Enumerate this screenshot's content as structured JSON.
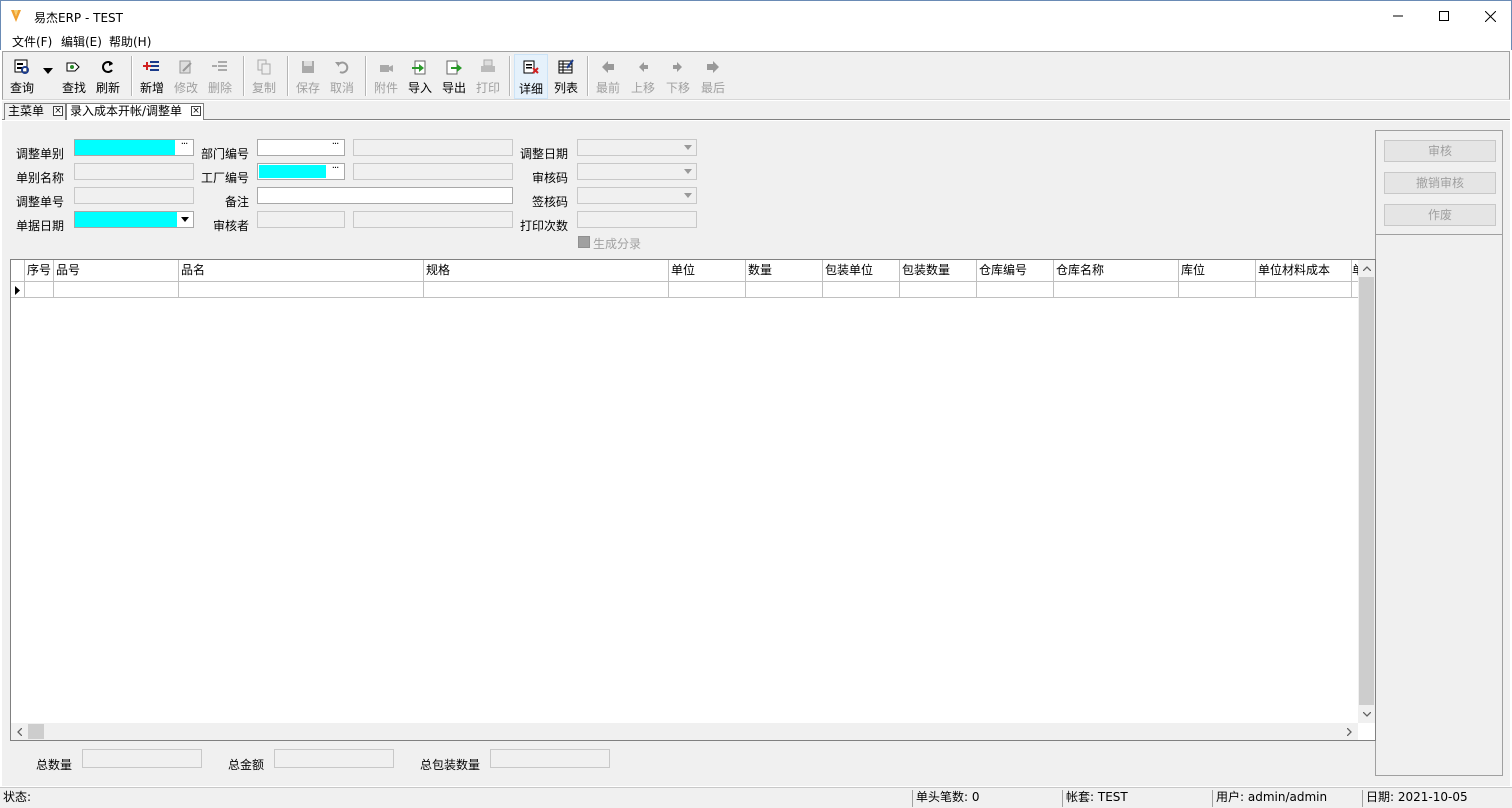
{
  "window": {
    "title": "易杰ERP - TEST"
  },
  "menu": [
    {
      "label": "文件(F)"
    },
    {
      "label": "编辑(E)"
    },
    {
      "label": "帮助(H)"
    }
  ],
  "toolbar": {
    "query": "查询",
    "find": "查找",
    "refresh": "刷新",
    "add": "新增",
    "modify": "修改",
    "delete": "删除",
    "copy": "复制",
    "save": "保存",
    "cancel": "取消",
    "attach": "附件",
    "import": "导入",
    "export": "导出",
    "print": "打印",
    "detail": "详细",
    "list": "列表",
    "first": "最前",
    "prev": "上移",
    "next": "下移",
    "last": "最后"
  },
  "tabs": [
    {
      "label": "主菜单"
    },
    {
      "label": "录入成本开帐/调整单"
    }
  ],
  "form": {
    "adjust_type_label": "调整单别",
    "type_name_label": "单别名称",
    "adjust_no_label": "调整单号",
    "doc_date_label": "单据日期",
    "dept_no_label": "部门编号",
    "factory_no_label": "工厂编号",
    "remark_label": "备注",
    "approver_label": "审核者",
    "adjust_date_label": "调整日期",
    "audit_code_label": "审核码",
    "sign_code_label": "签核码",
    "print_count_label": "打印次数",
    "gen_entry_label": "生成分录",
    "lookup_glyph": "···"
  },
  "right_panel": {
    "audit": "审核",
    "unaudit": "撤销审核",
    "void": "作废"
  },
  "grid": {
    "columns": [
      "序号",
      "品号",
      "品名",
      "规格",
      "单位",
      "数量",
      "包装单位",
      "包装数量",
      "仓库编号",
      "仓库名称",
      "库位",
      "单位材料成本",
      "单"
    ]
  },
  "totals": {
    "total_qty_label": "总数量",
    "total_amount_label": "总金额",
    "total_pack_label": "总包装数量"
  },
  "status": {
    "state": "状态:",
    "header_count": "单头笔数: 0",
    "account": "帐套: TEST",
    "user": "用户: admin/admin",
    "date": "日期: 2021-10-05"
  }
}
